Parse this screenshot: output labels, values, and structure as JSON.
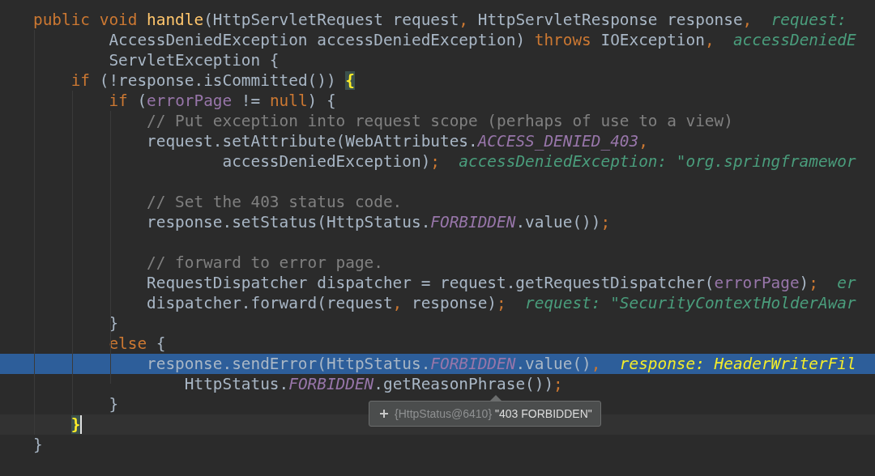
{
  "editor": {
    "lines": [
      {
        "tokens": [
          {
            "kind": "keyword",
            "text": "public void "
          },
          {
            "kind": "method",
            "text": "handle"
          },
          {
            "kind": "plain",
            "text": "(HttpServletRequest request"
          },
          {
            "kind": "punct",
            "text": ","
          },
          {
            "kind": "plain",
            "text": " HttpServletResponse response"
          },
          {
            "kind": "punct",
            "text": ","
          }
        ],
        "hint": "request:",
        "highlighted": false,
        "current": false,
        "continuation": [
          {
            "tokens": [
              {
                "kind": "plain",
                "text": "AccessDeniedException accessDeniedException) "
              },
              {
                "kind": "keyword",
                "text": "throws"
              },
              {
                "kind": "plain",
                "text": " IOException"
              },
              {
                "kind": "punct",
                "text": ","
              }
            ],
            "hint": "accessDeniedE",
            "highlighted": false,
            "current": false
          },
          {
            "tokens": [
              {
                "kind": "plain",
                "text": "ServletException {"
              }
            ],
            "highlighted": false,
            "current": false
          }
        ],
        "children": [
          {
            "tokens": [
              {
                "kind": "keyword",
                "text": "if"
              },
              {
                "kind": "plain",
                "text": " (!response.isCommitted()) "
              },
              {
                "kind": "brace_match",
                "text": "{"
              }
            ],
            "highlighted": false,
            "current": false,
            "children": [
              {
                "tokens": [
                  {
                    "kind": "keyword",
                    "text": "if"
                  },
                  {
                    "kind": "plain",
                    "text": " ("
                  },
                  {
                    "kind": "variable",
                    "text": "errorPage"
                  },
                  {
                    "kind": "plain",
                    "text": " != "
                  },
                  {
                    "kind": "keyword",
                    "text": "null"
                  },
                  {
                    "kind": "plain",
                    "text": ") {"
                  }
                ],
                "highlighted": false,
                "current": false,
                "children": [
                  {
                    "tokens": [
                      {
                        "kind": "comment",
                        "text": "// Put exception into request scope (perhaps of use to a view)"
                      }
                    ],
                    "highlighted": false,
                    "current": false
                  },
                  {
                    "tokens": [
                      {
                        "kind": "plain",
                        "text": "request.setAttribute(WebAttributes."
                      },
                      {
                        "kind": "constant",
                        "text": "ACCESS_DENIED_403"
                      },
                      {
                        "kind": "punct",
                        "text": ","
                      }
                    ],
                    "highlighted": false,
                    "current": false,
                    "continuation": [
                      {
                        "tokens": [
                          {
                            "kind": "plain",
                            "text": "accessDeniedException)"
                          },
                          {
                            "kind": "punct",
                            "text": ";"
                          }
                        ],
                        "hint": "accessDeniedException: \"org.springframewor",
                        "highlighted": false,
                        "current": false
                      }
                    ]
                  },
                  {
                    "highlighted": false,
                    "current": false
                  },
                  {
                    "tokens": [
                      {
                        "kind": "comment",
                        "text": "// Set the 403 status code."
                      }
                    ],
                    "highlighted": false,
                    "current": false
                  },
                  {
                    "tokens": [
                      {
                        "kind": "plain",
                        "text": "response.setStatus(HttpStatus."
                      },
                      {
                        "kind": "constant",
                        "text": "FORBIDDEN"
                      },
                      {
                        "kind": "plain",
                        "text": ".value())"
                      },
                      {
                        "kind": "punct",
                        "text": ";"
                      }
                    ],
                    "highlighted": false,
                    "current": false
                  },
                  {
                    "highlighted": false,
                    "current": false
                  },
                  {
                    "tokens": [
                      {
                        "kind": "comment",
                        "text": "// forward to error page."
                      }
                    ],
                    "highlighted": false,
                    "current": false
                  },
                  {
                    "tokens": [
                      {
                        "kind": "plain",
                        "text": "RequestDispatcher dispatcher = request.getRequestDispatcher("
                      },
                      {
                        "kind": "variable",
                        "text": "errorPage"
                      },
                      {
                        "kind": "plain",
                        "text": ")"
                      },
                      {
                        "kind": "punct",
                        "text": ";"
                      }
                    ],
                    "hint": "er",
                    "highlighted": false,
                    "current": false
                  },
                  {
                    "tokens": [
                      {
                        "kind": "plain",
                        "text": "dispatcher.forward(request"
                      },
                      {
                        "kind": "punct",
                        "text": ","
                      },
                      {
                        "kind": "plain",
                        "text": " response)"
                      },
                      {
                        "kind": "punct",
                        "text": ";"
                      }
                    ],
                    "hint": "request: \"SecurityContextHolderAwar",
                    "highlighted": false,
                    "current": false
                  }
                ]
              },
              {
                "tokens": [
                  {
                    "kind": "plain",
                    "text": "}"
                  }
                ],
                "highlighted": false,
                "current": false
              },
              {
                "tokens": [
                  {
                    "kind": "keyword",
                    "text": "else"
                  },
                  {
                    "kind": "plain",
                    "text": " {"
                  }
                ],
                "highlighted": false,
                "current": false,
                "children": [
                  {
                    "tokens": [
                      {
                        "kind": "plain",
                        "text": "response.sendError(HttpStatus."
                      },
                      {
                        "kind": "constant",
                        "text": "FORBIDDEN"
                      },
                      {
                        "kind": "plain",
                        "text": ".value()"
                      },
                      {
                        "kind": "punct",
                        "text": ","
                      }
                    ],
                    "hint": "response: HeaderWriterFil",
                    "highlighted": true,
                    "current": false,
                    "children": [
                      {
                        "tokens": [
                          {
                            "kind": "plain",
                            "text": "HttpStatus."
                          },
                          {
                            "kind": "constant",
                            "text": "FORBIDDEN"
                          },
                          {
                            "kind": "plain",
                            "text": ".getReasonPhrase())"
                          },
                          {
                            "kind": "punct",
                            "text": ";"
                          }
                        ],
                        "highlighted": false,
                        "current": false
                      }
                    ]
                  }
                ]
              },
              {
                "tokens": [
                  {
                    "kind": "plain",
                    "text": "}"
                  }
                ],
                "highlighted": false,
                "current": false
              }
            ]
          },
          {
            "tokens": [
              {
                "kind": "brace_match",
                "text": "}"
              }
            ],
            "highlighted": false,
            "current": true
          }
        ]
      },
      {
        "tokens": [
          {
            "kind": "plain",
            "text": "}"
          }
        ],
        "highlighted": false,
        "current": false
      }
    ]
  },
  "value_tooltip": {
    "type_label": "{HttpStatus@6410}",
    "value": "\"403 FORBIDDEN\""
  }
}
